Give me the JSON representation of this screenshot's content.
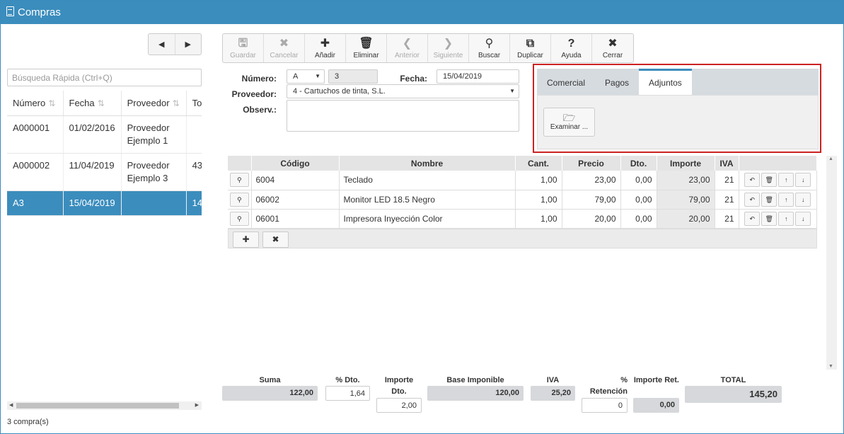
{
  "window": {
    "title": "Compras"
  },
  "left": {
    "search_placeholder": "Búsqueda Rápida (Ctrl+Q)",
    "columns": [
      "Número",
      "Fecha",
      "Proveedor",
      "Tota"
    ],
    "rows": [
      {
        "numero": "A000001",
        "fecha": "01/02/2016",
        "proveedor": "Proveedor Ejemplo 1",
        "total": ""
      },
      {
        "numero": "A000002",
        "fecha": "11/04/2019",
        "proveedor": "Proveedor Ejemplo 3",
        "total": "43"
      },
      {
        "numero": "A3",
        "fecha": "15/04/2019",
        "proveedor": "",
        "total": "14"
      }
    ],
    "selected_row": 2,
    "count": "3 compra(s)"
  },
  "toolbar": {
    "buttons": [
      {
        "label": "Guardar",
        "icon": "save-icon",
        "glyph": "🖫",
        "disabled": true
      },
      {
        "label": "Cancelar",
        "icon": "close-icon",
        "glyph": "✖",
        "disabled": true
      },
      {
        "label": "Añadir",
        "icon": "plus-icon",
        "glyph": "✚",
        "disabled": false
      },
      {
        "label": "Eliminar",
        "icon": "trash-icon",
        "glyph": "🗑",
        "disabled": false
      },
      {
        "label": "Anterior",
        "icon": "chevron-left-icon",
        "glyph": "❮",
        "disabled": true
      },
      {
        "label": "Siguiente",
        "icon": "chevron-right-icon",
        "glyph": "❯",
        "disabled": true
      },
      {
        "label": "Buscar",
        "icon": "search-icon",
        "glyph": "⚲",
        "disabled": false
      },
      {
        "label": "Duplicar",
        "icon": "copy-icon",
        "glyph": "⧉",
        "disabled": false
      },
      {
        "label": "Ayuda",
        "icon": "help-icon",
        "glyph": "?",
        "disabled": false
      },
      {
        "label": "Cerrar",
        "icon": "close-icon",
        "glyph": "✖",
        "disabled": false
      }
    ]
  },
  "form": {
    "numero_label": "Número:",
    "serie": "A",
    "numero": "3",
    "fecha_label": "Fecha:",
    "fecha": "15/04/2019",
    "proveedor_label": "Proveedor:",
    "proveedor": "4 - Cartuchos de tinta, S.L.",
    "observ_label": "Observ.:",
    "observ": ""
  },
  "tabs": {
    "items": [
      "Comercial",
      "Pagos",
      "Adjuntos"
    ],
    "active": 2,
    "browse_label": "Examinar ..."
  },
  "lines": {
    "columns": [
      "Código",
      "Nombre",
      "Cant.",
      "Precio",
      "Dto.",
      "Importe",
      "IVA"
    ],
    "rows": [
      {
        "codigo": "6004",
        "nombre": "Teclado",
        "cant": "1,00",
        "precio": "23,00",
        "dto": "0,00",
        "importe": "23,00",
        "iva": "21"
      },
      {
        "codigo": "06002",
        "nombre": "Monitor LED 18.5 Negro",
        "cant": "1,00",
        "precio": "79,00",
        "dto": "0,00",
        "importe": "79,00",
        "iva": "21"
      },
      {
        "codigo": "06001",
        "nombre": "Impresora Inyección Color",
        "cant": "1,00",
        "precio": "20,00",
        "dto": "0,00",
        "importe": "20,00",
        "iva": "21"
      }
    ]
  },
  "totals": {
    "suma_label": "Suma",
    "suma": "122,00",
    "pdto_label": "% Dto.",
    "pdto": "1,64",
    "importe_dto_label": "Importe Dto.",
    "importe_dto": "2,00",
    "base_label": "Base Imponible",
    "base": "120,00",
    "iva_label": "IVA",
    "iva": "25,20",
    "pret_label": "% Retención",
    "pret": "0",
    "importe_ret_label": "Importe Ret.",
    "importe_ret": "0,00",
    "total_label": "TOTAL",
    "total": "145,20"
  }
}
